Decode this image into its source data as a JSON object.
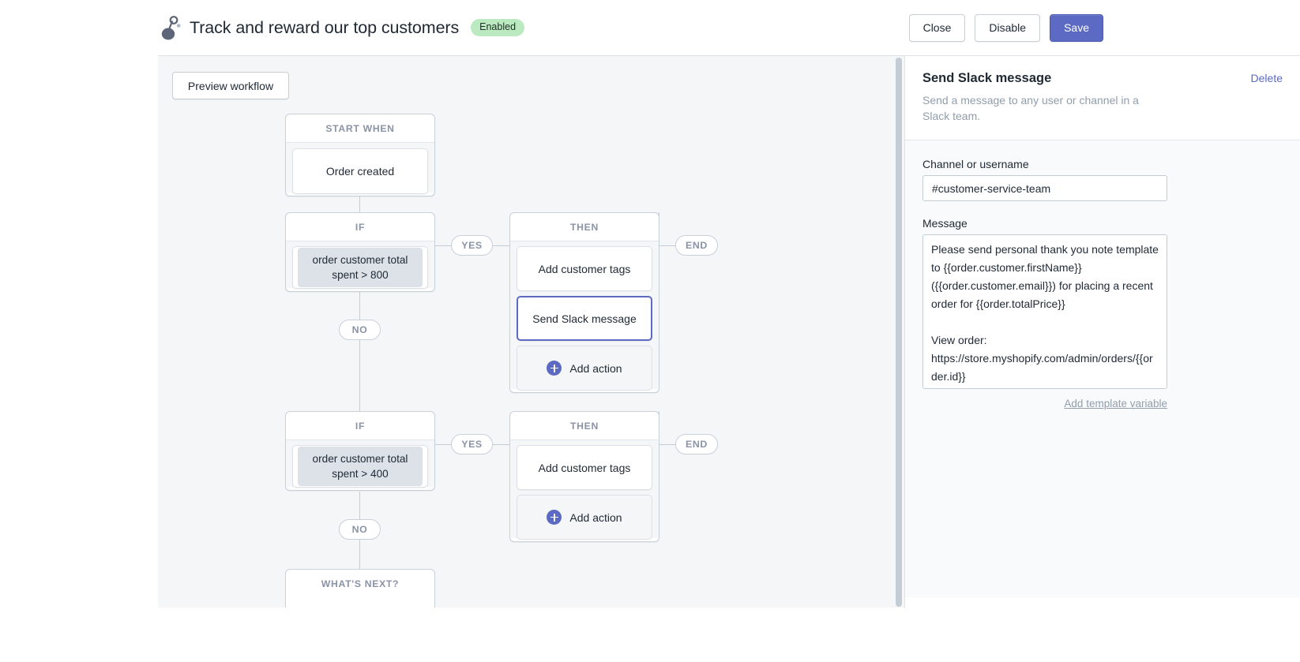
{
  "header": {
    "icon": "workflow-node-icon",
    "title": "Track and reward our top customers",
    "status": "Enabled",
    "buttons": {
      "close": "Close",
      "disable": "Disable",
      "save": "Save"
    }
  },
  "canvas": {
    "preview_button": "Preview workflow",
    "nodes": [
      {
        "head": "START WHEN",
        "card": "Order created"
      },
      {
        "head": "IF",
        "condition": "order customer total spent > 800"
      },
      {
        "head": "THEN",
        "actions": [
          "Add customer tags",
          "Send Slack message"
        ],
        "add_action": "Add action"
      },
      {
        "head": "IF",
        "condition": "order customer total spent > 400"
      },
      {
        "head": "THEN",
        "actions": [
          "Add customer tags"
        ],
        "add_action": "Add action"
      },
      {
        "head": "WHAT'S NEXT?"
      }
    ],
    "pills": {
      "yes": "YES",
      "no": "NO",
      "end": "END"
    },
    "selected_action": "Send Slack message"
  },
  "panel": {
    "title": "Send Slack message",
    "delete": "Delete",
    "description": "Send a message to any user or channel in a Slack team.",
    "channel_label": "Channel or username",
    "channel_value": "#customer-service-team",
    "message_label": "Message",
    "message_value": "Please send personal thank you note template to {{order.customer.firstName}} ({{order.customer.email}}) for placing a recent order for {{order.totalPrice}}\n\nView order: https://store.myshopify.com/admin/orders/{{order.id}}",
    "template_link": "Add template variable"
  },
  "colors": {
    "accent": "#5c6ac4",
    "canvas_bg": "#f4f6f8",
    "badge_bg": "#bbeac0",
    "muted_text": "#8a94a6"
  }
}
